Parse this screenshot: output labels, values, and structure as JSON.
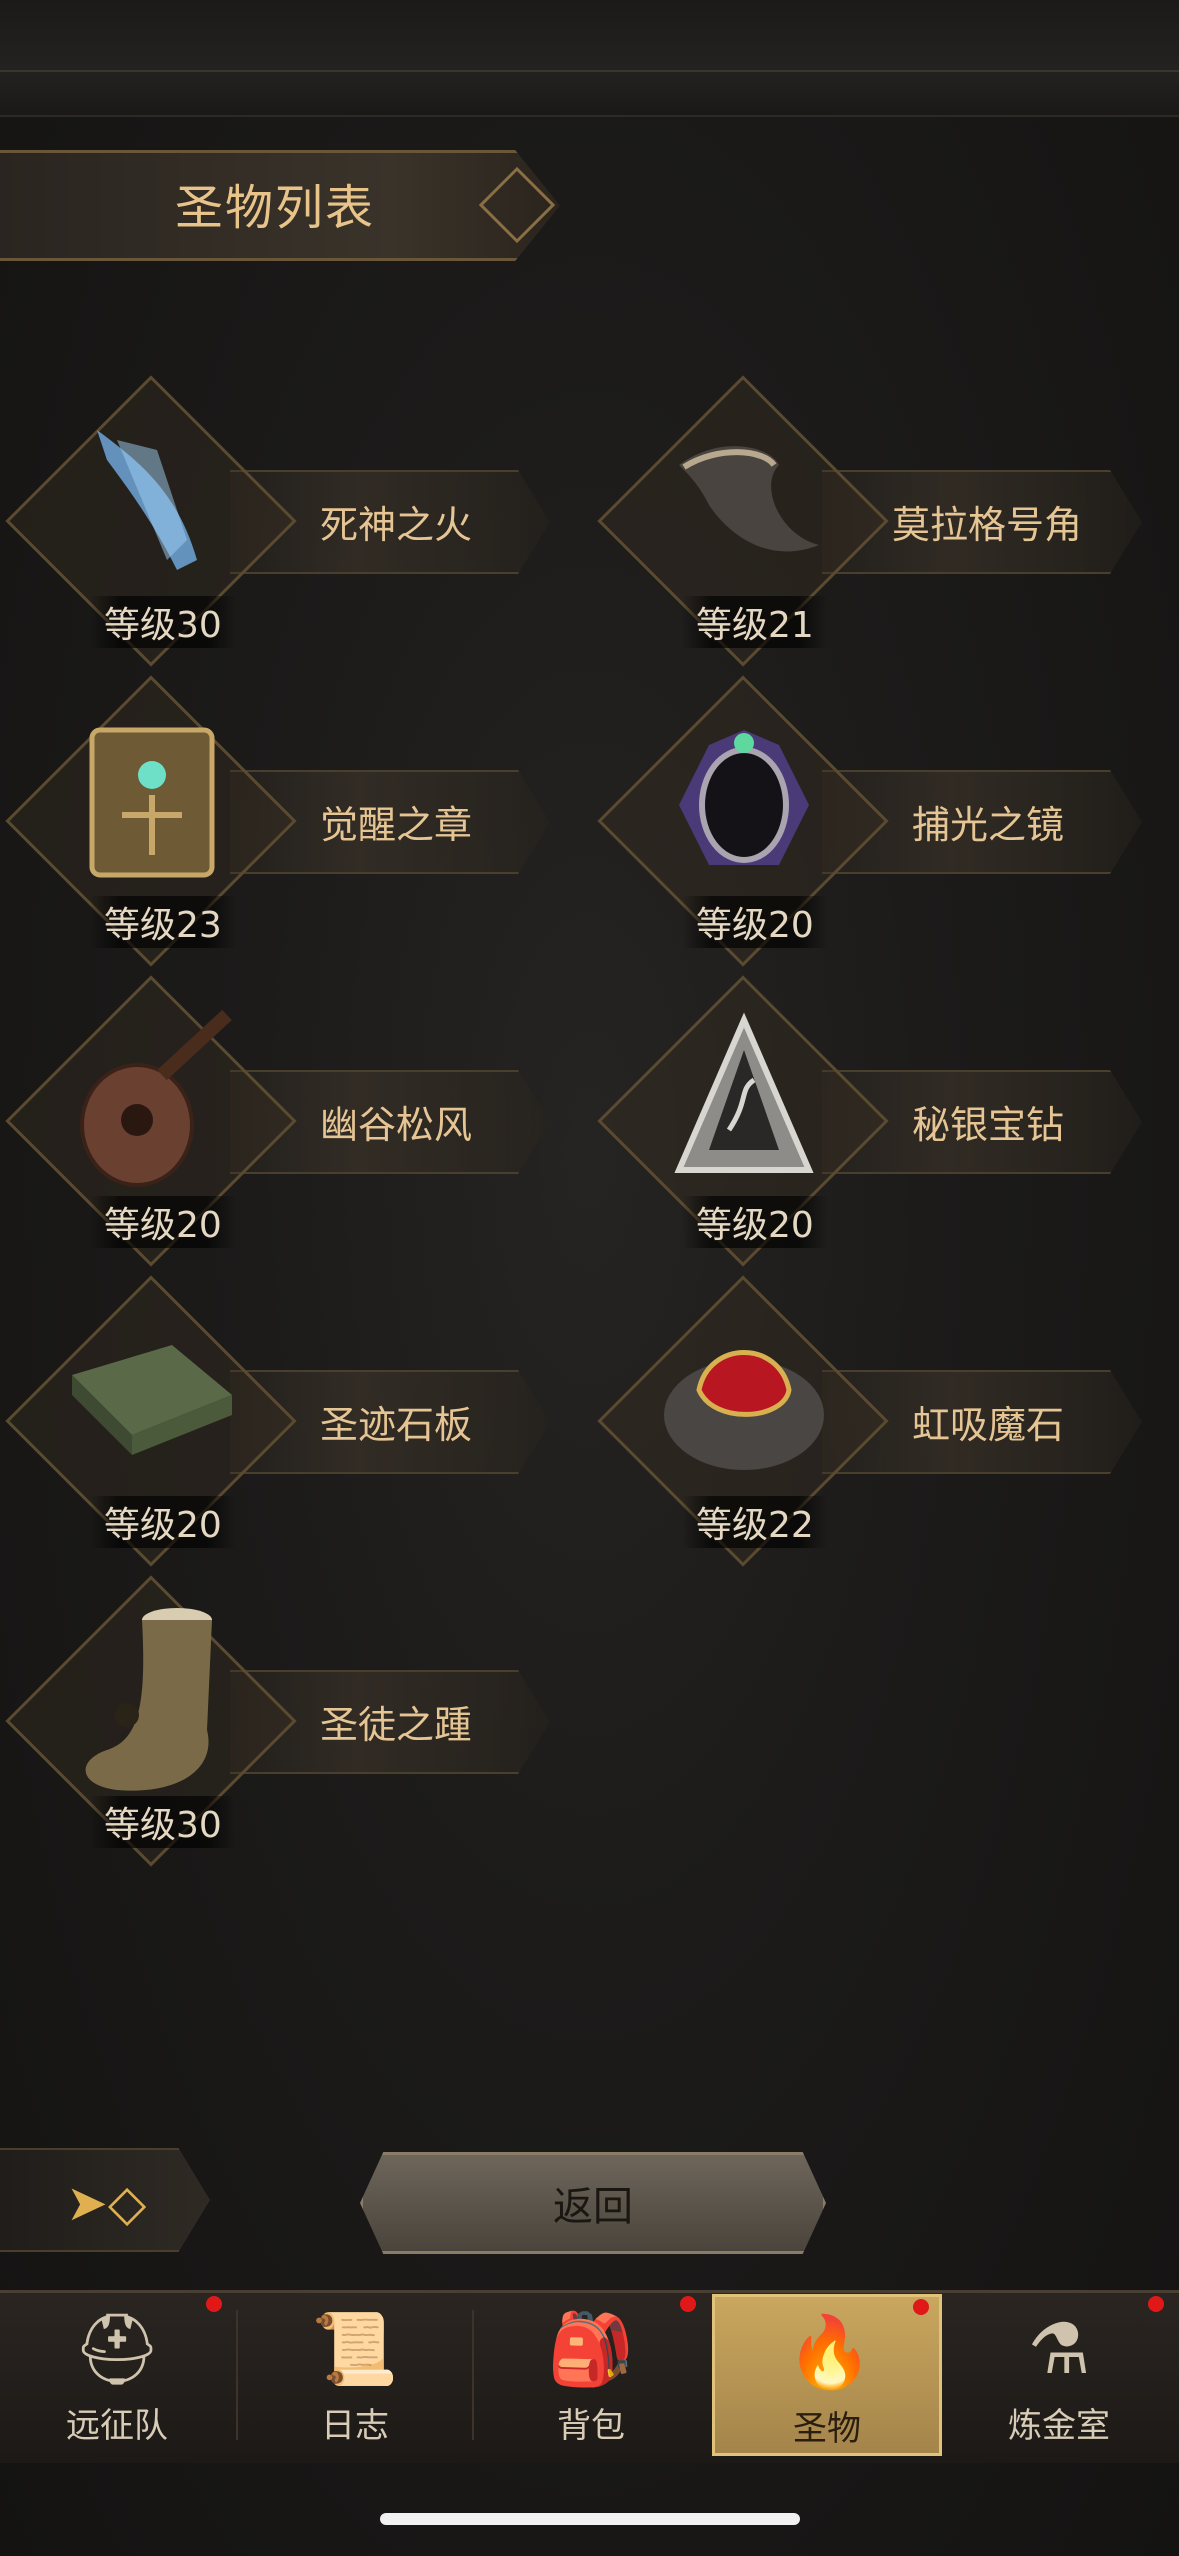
{
  "header": {
    "title": "圣物列表"
  },
  "relics": [
    {
      "name": "死神之火",
      "level": "等级30",
      "icon": "spectral-hand-icon"
    },
    {
      "name": "莫拉格号角",
      "level": "等级21",
      "icon": "horn-icon"
    },
    {
      "name": "觉醒之章",
      "level": "等级23",
      "icon": "tome-icon"
    },
    {
      "name": "捕光之镜",
      "level": "等级20",
      "icon": "crystal-mirror-icon"
    },
    {
      "name": "幽谷松风",
      "level": "等级20",
      "icon": "lute-icon"
    },
    {
      "name": "秘银宝钻",
      "level": "等级20",
      "icon": "pyramid-gem-icon"
    },
    {
      "name": "圣迹石板",
      "level": "等级20",
      "icon": "stone-tablet-icon"
    },
    {
      "name": "虹吸魔石",
      "level": "等级22",
      "icon": "red-stone-icon"
    },
    {
      "name": "圣徒之踵",
      "level": "等级30",
      "icon": "saint-foot-icon"
    }
  ],
  "controls": {
    "return_label": "返回",
    "collapse_icon": "arrow-diamond-icon"
  },
  "nav": {
    "tabs": [
      {
        "label": "远征队",
        "icon": "horned-helmet-icon",
        "badge": true
      },
      {
        "label": "日志",
        "icon": "scroll-icon",
        "badge": false
      },
      {
        "label": "背包",
        "icon": "backpack-icon",
        "badge": true
      },
      {
        "label": "圣物",
        "icon": "torch-icon",
        "badge": true,
        "active": true
      },
      {
        "label": "炼金室",
        "icon": "alchemy-icon",
        "badge": true
      }
    ]
  }
}
